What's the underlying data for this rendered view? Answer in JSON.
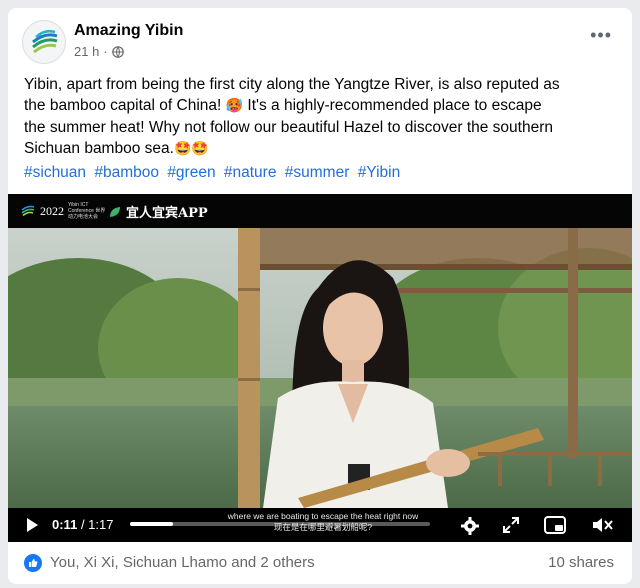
{
  "post": {
    "page_name": "Amazing Yibin",
    "time": "21 h",
    "separator": "·",
    "privacy_icon": "globe-icon",
    "more_icon": "more-options-icon",
    "text_line1": "Yibin, apart from being the first city along the Yangtze River, is also reputed as",
    "text_line2_a": "the bamboo capital of China!",
    "text_line2_b": "It's a highly-recommended place to escape",
    "text_line3": "the summer heat! Why not follow our beautiful Hazel to discover the southern",
    "text_line4": "Sichuan bamboo sea.",
    "emoji_hot": "🥵",
    "emoji_star_1": "🤩",
    "emoji_star_2": "🤩",
    "hashtags": [
      "#sichuan",
      "#bamboo",
      "#green",
      "#nature",
      "#summer",
      "#Yibin"
    ]
  },
  "video": {
    "logo_year": "2022",
    "logo_sub": "Yibin ICT Conference 世界动力电池大会",
    "app_name": "宜人宜宾APP",
    "app_sub": "APP",
    "current_time": "0:11",
    "duration": "/ 1:17",
    "progress_fraction": 0.143,
    "subtitle_en": "where we are boating to escape the heat right now",
    "subtitle_zh": "现在是在哪里避暑划船呢?",
    "icons": [
      "play-icon",
      "settings-icon",
      "fullscreen-icon",
      "picture-in-picture-icon",
      "mute-icon"
    ]
  },
  "footer": {
    "reactors": "You, Xi Xi, Sichuan Lhamo and 2 others",
    "shares": "10 shares"
  },
  "colors": {
    "hashtag": "#216fdb",
    "like_blue": "#1877f2"
  }
}
